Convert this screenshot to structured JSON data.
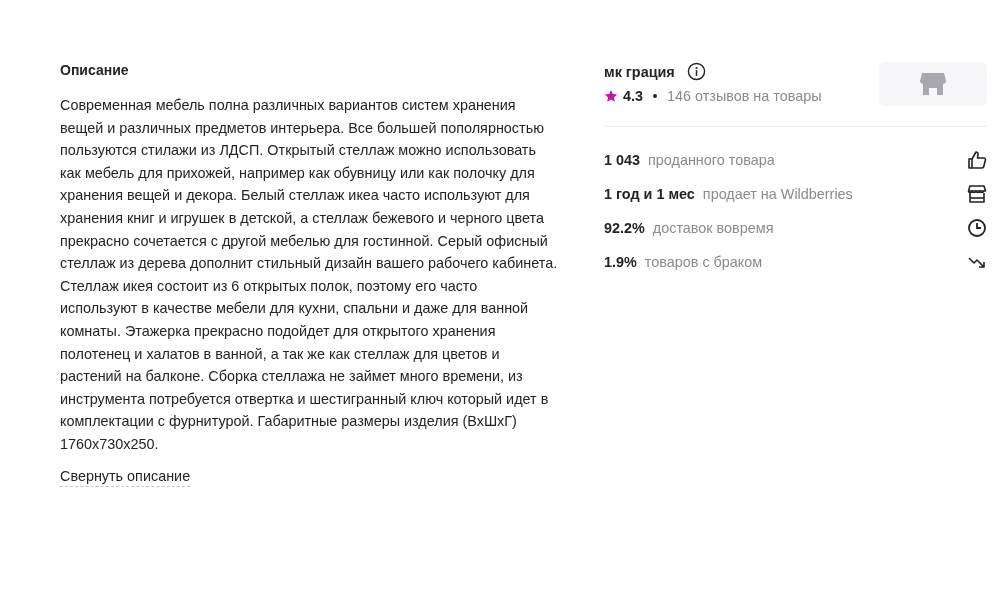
{
  "description": {
    "title": "Описание",
    "text": "Современная мебель полна различных вариантов систем хранения вещей и различных предметов интерьера. Все большей пополярностью пользуются стилажи из ЛДСП. Открытый стеллаж можно использовать как мебель для прихожей, например как обувницу или как полочку для хранения вещей и декора. Белый стеллаж икеа часто используют для хранения книг и игрушек в детской, а стеллаж бежевого и черного цвета прекрасно сочетается с другой мебелью для гостинной. Серый офисный стеллаж из дерева дополнит стильный дизайн вашего рабочего кабинета. Стеллаж икея состоит из 6 открытых полок, поэтому его часто используют в качестве мебели для кухни, спальни и даже для ванной комнаты. Этажерка прекрасно подойдет для открытого хранения полотенец и халатов в ванной, а так же как стеллаж для цветов и растений на балконе. Сборка стеллажа не займет много времени, из инструмента потребуется отвертка и шестигранный ключ который идет в комплектации с фурнитурой. Габаритные размеры изделия (ВхШхГ) 1760х730х250.",
    "toggle": "Свернуть описание"
  },
  "seller": {
    "name": "мк грация",
    "rating": "4.3",
    "reviews": "146 отзывов на товары",
    "stats": [
      {
        "value": "1 043",
        "label": "проданного товара",
        "kind": "thumb"
      },
      {
        "value": "1 год и 1 мес",
        "label": "продает на Wildberries",
        "kind": "store"
      },
      {
        "value": "92.2%",
        "label": "доставок вовремя",
        "kind": "clock"
      },
      {
        "value": "1.9%",
        "label": "товаров с браком",
        "kind": "trend"
      }
    ]
  }
}
